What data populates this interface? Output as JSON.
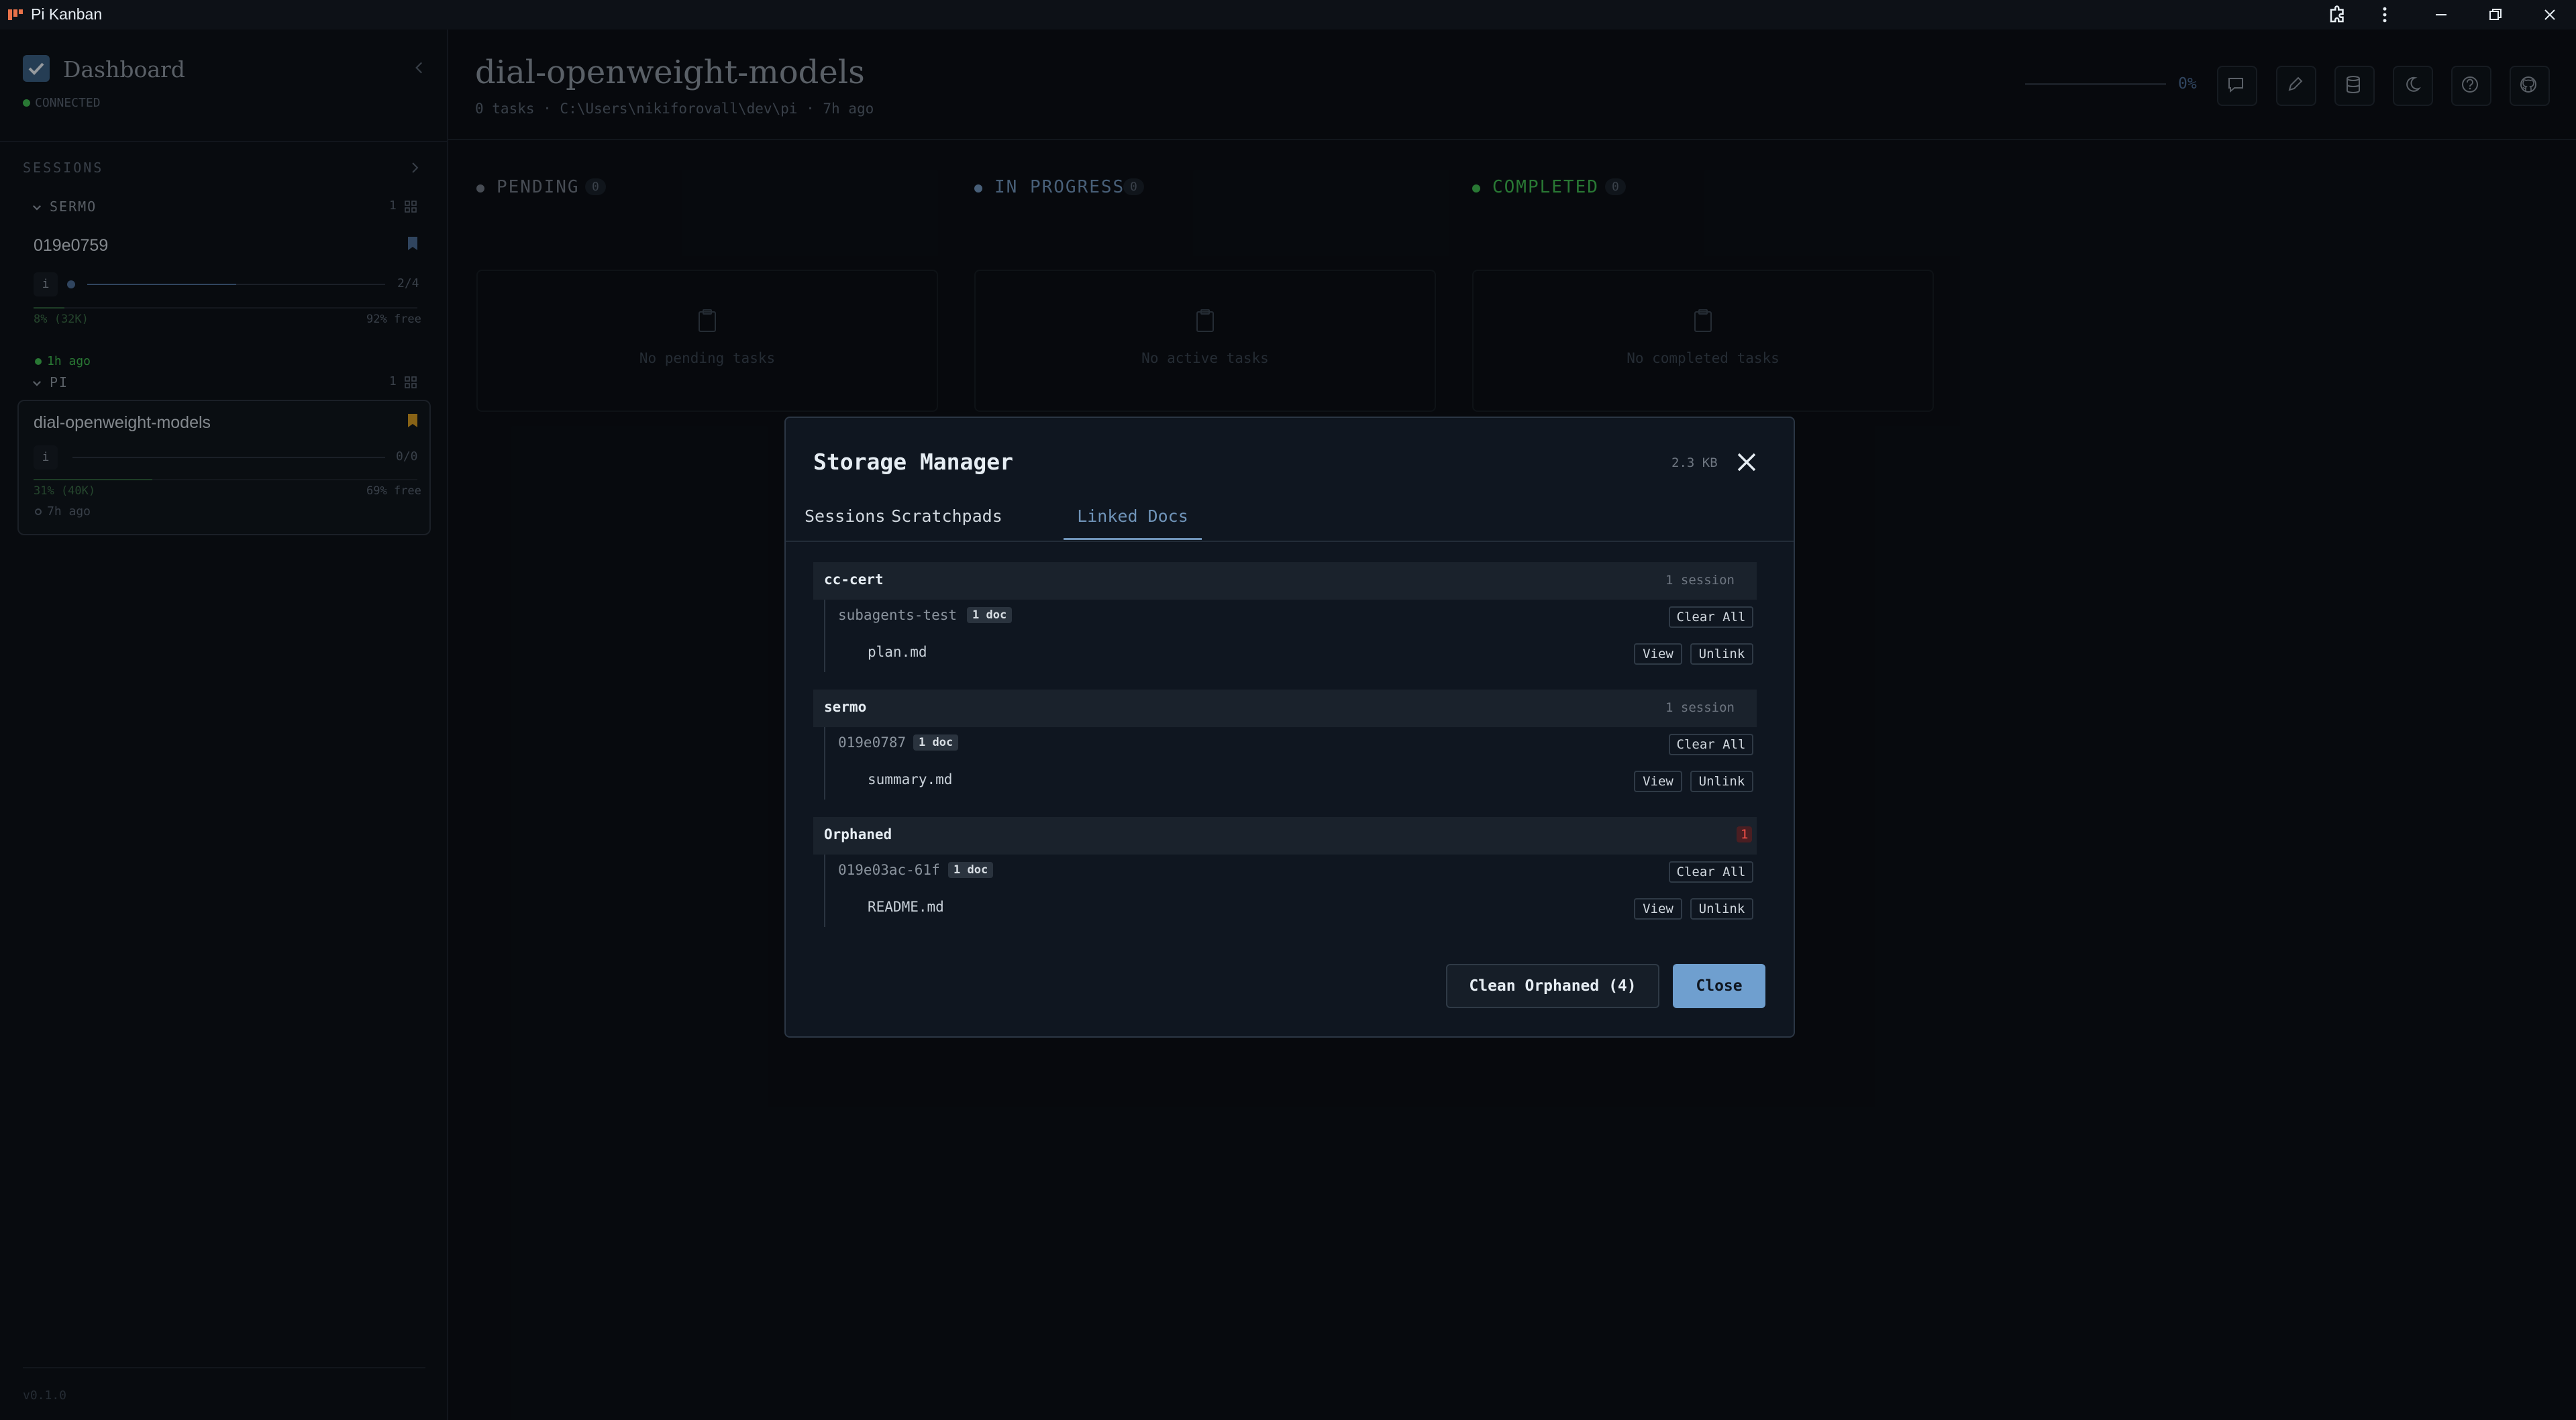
{
  "window": {
    "app_title": "Pi Kanban",
    "accent_color": "#e8724a"
  },
  "sidebar": {
    "dashboard_label": "Dashboard",
    "connection_status": "CONNECTED",
    "sessions_label": "SESSIONS",
    "version": "v0.1.0",
    "groups": [
      {
        "name": "SERMO",
        "count": "1",
        "session": {
          "title": "019e0759",
          "progress_text": "2/4",
          "progress_fraction": 0.5,
          "usage": "8% (32K)",
          "free": "92% free",
          "usage_fraction": 0.08,
          "time": "1h ago"
        }
      },
      {
        "name": "PI",
        "count": "1",
        "session": {
          "title": "dial-openweight-models",
          "progress_text": "0/0",
          "progress_fraction": 0,
          "usage": "31% (40K)",
          "free": "69% free",
          "usage_fraction": 0.31,
          "time": "7h ago"
        }
      }
    ]
  },
  "header": {
    "title": "dial-openweight-models",
    "meta": "0 tasks · C:\\Users\\nikiforovall\\dev\\pi · 7h ago",
    "progress_percent": "0%",
    "progress_fraction": 0
  },
  "board": {
    "columns": [
      {
        "label": "PENDING",
        "count": "0",
        "empty_text": "No pending tasks",
        "color": "#6e7681"
      },
      {
        "label": "IN PROGRESS",
        "count": "0",
        "empty_text": "No active tasks",
        "color": "#6f93b8"
      },
      {
        "label": "COMPLETED",
        "count": "0",
        "empty_text": "No completed tasks",
        "color": "#3fb950"
      }
    ]
  },
  "modal": {
    "title": "Storage Manager",
    "size": "2.3 KB",
    "tabs": [
      "Sessions",
      "Scratchpads",
      "Linked Docs"
    ],
    "active_tab": "Linked Docs",
    "groups": [
      {
        "name": "cc-cert",
        "meta": "1 session",
        "session": "subagents-test",
        "badge": "1 doc",
        "clear_label": "Clear All",
        "doc": "plan.md"
      },
      {
        "name": "sermo",
        "meta": "1 session",
        "session": "019e0787",
        "badge": "1 doc",
        "clear_label": "Clear All",
        "doc": "summary.md"
      },
      {
        "name": "Orphaned",
        "meta": "1",
        "session": "019e03ac-61f",
        "badge": "1 doc",
        "clear_label": "Clear All",
        "doc": "README.md"
      }
    ],
    "view_label": "View",
    "unlink_label": "Unlink",
    "clean_orphaned_label": "Clean Orphaned (4)",
    "close_label": "Close"
  }
}
